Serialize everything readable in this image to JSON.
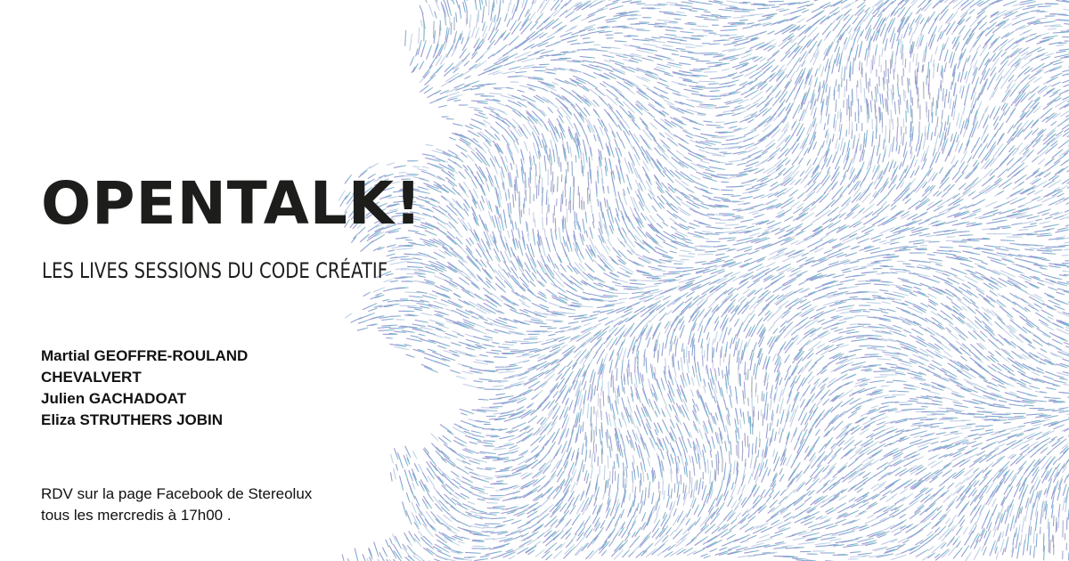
{
  "poster": {
    "title": "OPENTALK!",
    "subtitle": "LES LIVES SESSIONS DU CODE CRÉATIF",
    "speakers": [
      "Martial GEOFFRE-ROULAND",
      "CHEVALVERT",
      "Julien GACHADOAT",
      "Eliza STRUTHERS JOBIN"
    ],
    "info_line_1": "RDV sur la page Facebook de Stereolux",
    "info_line_2": "tous les mercredis à 17h00 ."
  },
  "colors": {
    "background": "#ffffff",
    "text": "#1d1d1b",
    "art_purple": "#8f86c4",
    "art_blue": "#4fb0cf",
    "art_grey": "#a9b2b6"
  },
  "artwork": {
    "description_icon": "flow-field-pattern"
  }
}
